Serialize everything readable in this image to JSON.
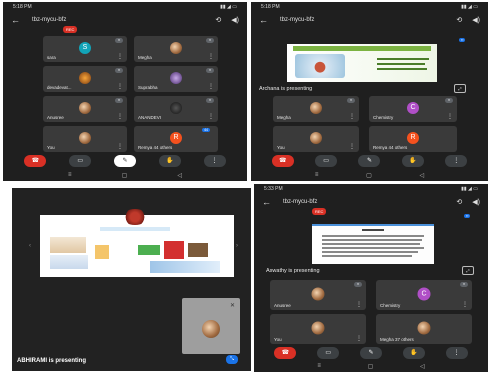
{
  "status_time_1": "5:18 PM",
  "status_time_3": "5:33 PM",
  "meeting_code": "tbz-mycu-bfz",
  "rec_label": "REC",
  "panel1": {
    "tiles": [
      {
        "name": "sara",
        "avatar_letter": "S",
        "avatar_color": "#12a4b8"
      },
      {
        "name": "Megha",
        "avatar_letter": "",
        "avatar_color": ""
      },
      {
        "name": "devadevat...",
        "avatar_letter": "",
        "avatar_color": ""
      },
      {
        "name": "Suprabha",
        "avatar_letter": "",
        "avatar_color": ""
      },
      {
        "name": "Anusree",
        "avatar_letter": "",
        "avatar_color": ""
      },
      {
        "name": "ANANDEVI",
        "avatar_letter": "",
        "avatar_color": ""
      },
      {
        "name": "You",
        "avatar_letter": "",
        "avatar_color": ""
      },
      {
        "name": "Remya  44 others",
        "avatar_letter": "R",
        "avatar_color": "#f4511e"
      }
    ]
  },
  "panel2": {
    "presenter": "Archana is presenting",
    "tiles": [
      {
        "name": "Megha",
        "avatar_letter": "",
        "avatar_color": ""
      },
      {
        "name": "Chemistry",
        "avatar_letter": "C",
        "avatar_color": "#b04fc7"
      },
      {
        "name": "You",
        "avatar_letter": "",
        "avatar_color": ""
      },
      {
        "name": "Remya  44 others",
        "avatar_letter": "R",
        "avatar_color": "#f4511e"
      }
    ]
  },
  "panel3": {
    "presenter": "ABHIRAMI is presenting"
  },
  "panel4": {
    "presenter": "Aswathy is presenting",
    "tiles": [
      {
        "name": "Anusree",
        "avatar_letter": "",
        "avatar_color": ""
      },
      {
        "name": "Chemistry",
        "avatar_letter": "C",
        "avatar_color": "#b04fc7"
      },
      {
        "name": "You",
        "avatar_letter": "",
        "avatar_color": ""
      },
      {
        "name": "Megha  37 others",
        "avatar_letter": "",
        "avatar_color": ""
      }
    ]
  },
  "icons": {
    "back": "arrow-left-icon",
    "cam_flip": "camera-flip-icon",
    "speaker": "speaker-icon",
    "more": "more-vert-icon"
  },
  "colors": {
    "end_call": "#d93025",
    "bg": "#1f1f1f",
    "tile": "#3a3a3a"
  }
}
